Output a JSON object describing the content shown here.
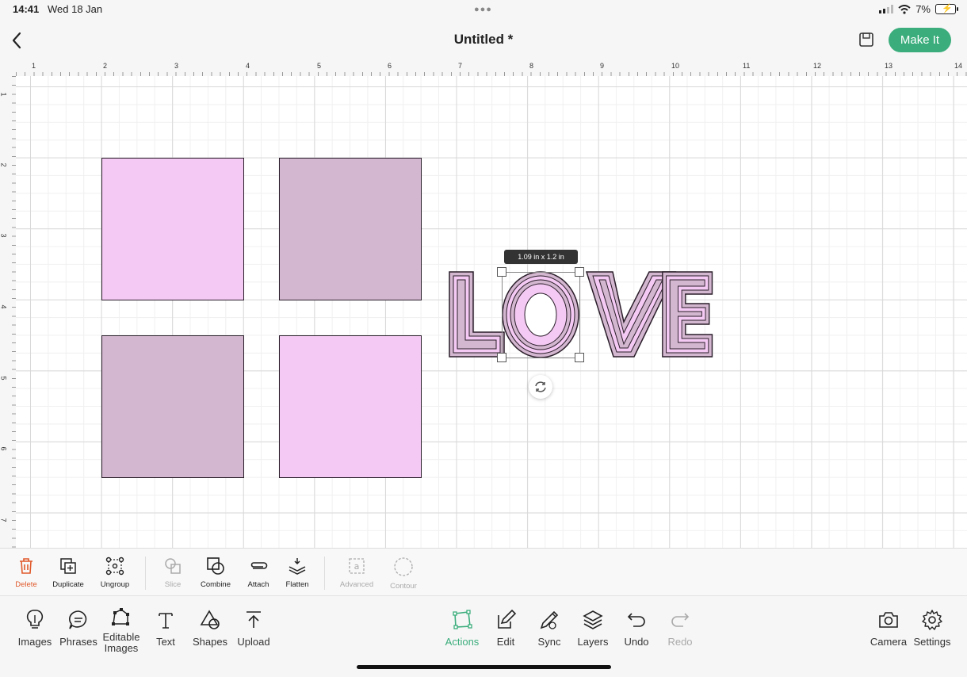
{
  "status_bar": {
    "time": "14:41",
    "date": "Wed 18 Jan",
    "battery": "7%"
  },
  "header": {
    "title": "Untitled *",
    "make_it_label": "Make It"
  },
  "ruler": {
    "top": [
      "1",
      "2",
      "3",
      "4",
      "5",
      "6",
      "7",
      "8",
      "9",
      "10",
      "11",
      "12",
      "13",
      "14"
    ],
    "left": [
      "1",
      "2",
      "3",
      "4",
      "5",
      "6",
      "7"
    ]
  },
  "canvas": {
    "dimension_tooltip": "1.09 in x 1.2 in",
    "word": "LOVE"
  },
  "colors": {
    "accent": "#3bad7c",
    "pink": "#f4c9f3",
    "mauve": "#d3b6cf",
    "delete": "#e0592a"
  },
  "action_bar": {
    "delete": "Delete",
    "duplicate": "Duplicate",
    "ungroup": "Ungroup",
    "slice": "Slice",
    "combine": "Combine",
    "attach": "Attach",
    "flatten": "Flatten",
    "advanced": "Advanced",
    "contour": "Contour"
  },
  "bottom_bar": {
    "images": "Images",
    "phrases": "Phrases",
    "editable_images": "Editable Images",
    "text": "Text",
    "shapes": "Shapes",
    "upload": "Upload",
    "actions": "Actions",
    "edit": "Edit",
    "sync": "Sync",
    "layers": "Layers",
    "undo": "Undo",
    "redo": "Redo",
    "camera": "Camera",
    "settings": "Settings"
  }
}
